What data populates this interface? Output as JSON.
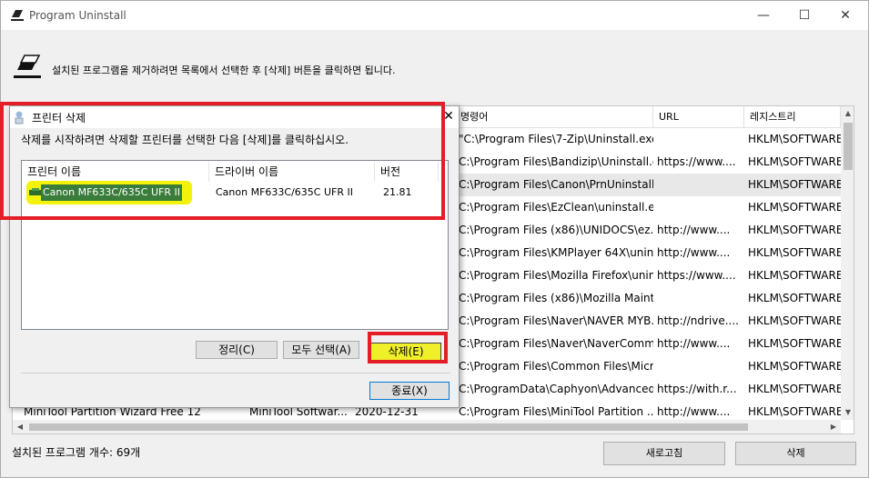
{
  "window": {
    "title": "Program Uninstall",
    "controls": {
      "minimize": "—",
      "maximize": "☐",
      "close": "✕"
    }
  },
  "header": {
    "text": "설치된 프로그램을 제거하려면 목록에서 선택한 후 [삭제] 버튼을 클릭하면 됩니다."
  },
  "list": {
    "columns": [
      "명령어",
      "URL",
      "레지스트리"
    ],
    "rows": [
      [
        "\"C:\\Program Files\\7-Zip\\Uninstall.exe\"",
        "",
        "HKLM\\SOFTWARE"
      ],
      [
        "C:\\Program Files\\Bandizip\\Uninstall.exe",
        "https://www....",
        "HKLM\\SOFTWARE"
      ],
      [
        "C:\\Program Files\\Canon\\PrnUninstall...",
        "",
        "HKLM\\SOFTWARE"
      ],
      [
        "C:\\Program Files\\EzClean\\uninstall.exe",
        "",
        "HKLM\\SOFTWARE"
      ],
      [
        "C:\\Program Files (x86)\\UNIDOCS\\ez...",
        "http://www....",
        "HKLM\\SOFTWARE"
      ],
      [
        "C:\\Program Files\\KMPlayer 64X\\unin...",
        "http://www....",
        "HKLM\\SOFTWARE"
      ],
      [
        "C:\\Program Files\\Mozilla Firefox\\unin...",
        "https://www....",
        "HKLM\\SOFTWARE"
      ],
      [
        "C:\\Program Files (x86)\\Mozilla Mainte...",
        "",
        "HKLM\\SOFTWARE"
      ],
      [
        "C:\\Program Files\\Naver\\NAVER MYB...",
        "http://ndrive....",
        "HKLM\\SOFTWARE"
      ],
      [
        "C:\\Program Files\\Naver\\NaverComm...",
        "http://www....",
        "HKLM\\SOFTWARE"
      ],
      [
        "C:\\Program Files\\Common Files\\Micr...",
        "",
        "HKLM\\SOFTWARE"
      ],
      [
        "C:\\ProgramData\\Caphyon\\Advanced...",
        "https://with.r...",
        "HKLM\\SOFTWARE"
      ],
      [
        "C:\\Program Files\\MiniTool Partition ...",
        "http://www....",
        "HKLM\\SOFTWARE"
      ]
    ],
    "partial_row": {
      "name": "MiniTool Partition Wizard Free 12",
      "publisher": "MiniTool Softwar...",
      "date": "2020-12-31"
    }
  },
  "footer": {
    "count_label": "설치된 프로그램 개수: 69개",
    "refresh_label": "새로고침",
    "uninstall_label": "삭제"
  },
  "dialog": {
    "title": "프린터 삭제",
    "close": "✕",
    "description": "삭제를 시작하려면 삭제할 프린터를 선택한 다음 [삭제]를 클릭하십시오.",
    "columns": {
      "name": "프린터 이름",
      "driver": "드라이버 이름",
      "version": "버전"
    },
    "printer": {
      "name": "Canon MF633C/635C UFR II",
      "driver": "Canon MF633C/635C UFR II",
      "version": "21.81"
    },
    "buttons": {
      "cleanup": "정리(C)",
      "select_all": "모두 선택(A)",
      "delete": "삭제(E)",
      "close": "종료(X)"
    }
  },
  "colors": {
    "annotation_red": "#e31e26",
    "highlight_yellow": "#f2f20a",
    "selection_green": "#3a7c3a"
  }
}
